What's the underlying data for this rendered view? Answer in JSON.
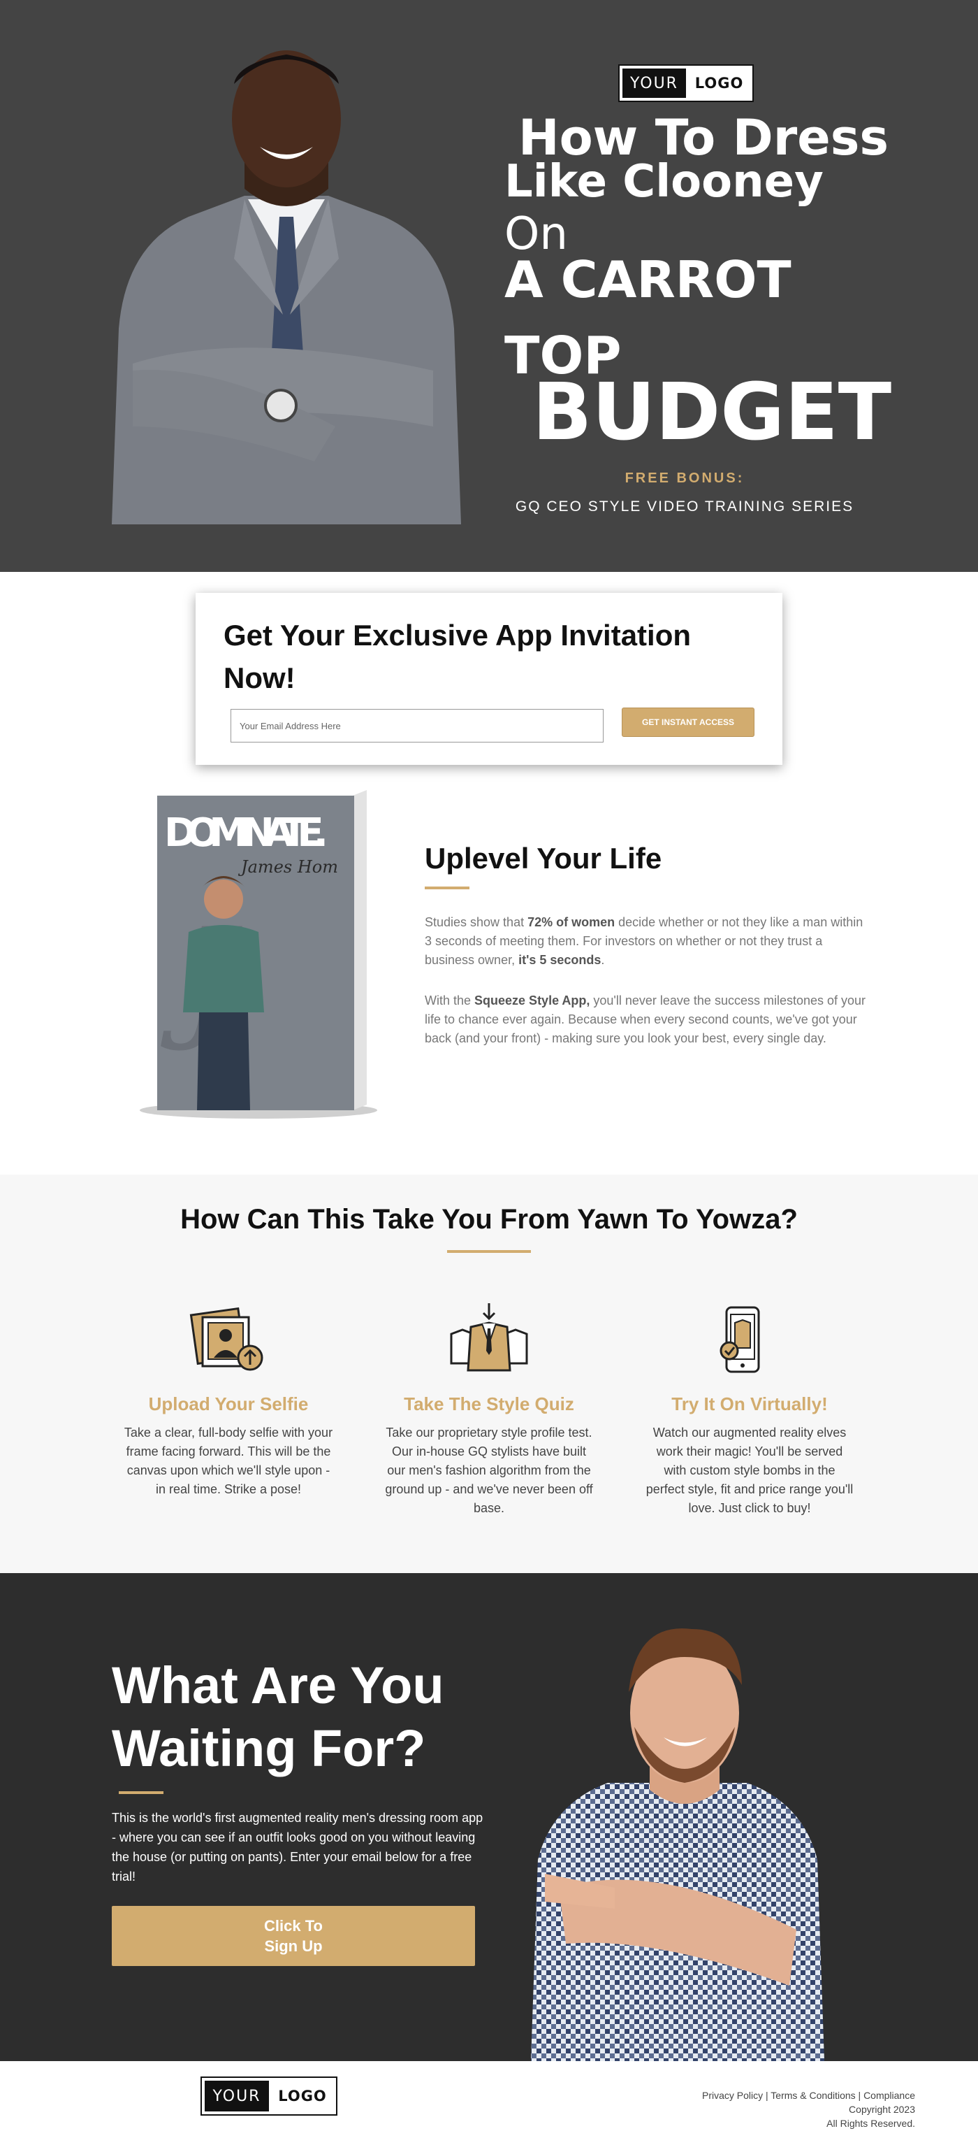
{
  "logo": {
    "part1": "YOUR",
    "part2": "LOGO"
  },
  "hero": {
    "line1": "How To Dress",
    "line2": "Like Clooney",
    "line3": "On",
    "line4": "A CARROT",
    "line5": "TOP",
    "line6": "BUDGET",
    "bonus_label": "FREE BONUS:",
    "bonus_text": "GQ CEO STYLE VIDEO TRAINING SERIES"
  },
  "optin": {
    "title": "Get Your Exclusive App Invitation Now!",
    "email_placeholder": "Your Email Address Here",
    "button_label": "GET INSTANT ACCESS"
  },
  "book": {
    "title": "DOMINATE.",
    "author": "James Hom",
    "spine_letter": "J"
  },
  "uplevel": {
    "title": "Uplevel Your Life",
    "p1_a": "Studies show that ",
    "p1_b": "72% of women",
    "p1_c": " decide whether or not they like a man within 3 seconds of meeting them.  For investors on whether or not they trust a business owner, ",
    "p1_d": "it's 5 seconds",
    "p1_e": ".",
    "p2_a": "With the ",
    "p2_b": "Squeeze Style App,",
    "p2_c": " you'll never leave the success milestones of your life to chance ever again.   Because when every second counts, we've got your back (and your front) - making sure you look your best, every single day."
  },
  "how": {
    "title": "How Can This Take You From Yawn To Yowza?",
    "steps": [
      {
        "icon": "photo-upload-icon",
        "title": "Upload Your Selfie",
        "text": "Take a clear, full-body selfie with your frame facing forward.  This will be the canvas upon which we'll style upon - in real time.  Strike a pose!"
      },
      {
        "icon": "suit-quiz-icon",
        "title": "Take The Style Quiz",
        "text": "Take our proprietary style profile test.  Our in-house GQ stylists have built our men's fashion algorithm from the ground up - and we've never been off base."
      },
      {
        "icon": "phone-tryon-icon",
        "title": "Try It On Virtually!",
        "text": "Watch our augmented reality elves work their magic! You'll be served with custom style bombs in the perfect style, fit and price range you'll love. Just click to buy!"
      }
    ]
  },
  "wait": {
    "title": "What Are You Waiting For?",
    "text": "This is the world's first augmented reality men's dressing room app - where you can see if an outfit looks good on you without leaving the house (or putting on pants). Enter your email below for a free trial!",
    "button_line1": "Click To",
    "button_line2": "Sign Up"
  },
  "footer": {
    "links": "Privacy Policy | Terms & Conditions | Compliance",
    "copyright": "Copyright 2023",
    "rights": "All Rights Reserved."
  },
  "colors": {
    "accent": "#d2ac6f",
    "hero_bg": "#444444",
    "dark_bg": "#2d2d2d",
    "light_bg": "#f7f7f7"
  }
}
